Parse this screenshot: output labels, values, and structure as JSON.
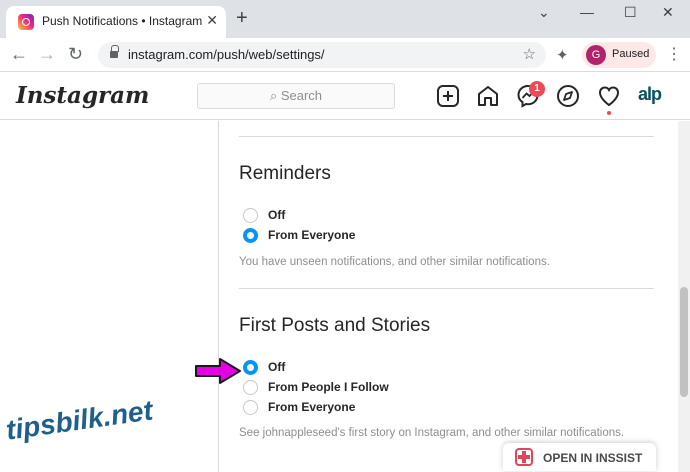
{
  "browser": {
    "tab_title": "Push Notifications • Instagram",
    "url": "instagram.com/push/web/settings/",
    "profile_initial": "G",
    "profile_status": "Paused"
  },
  "instagram": {
    "logo": "Instagram",
    "search_placeholder": "Search",
    "messages_badge": "1",
    "profile_handle": "alp"
  },
  "sections": {
    "reminders": {
      "title": "Reminders",
      "options": [
        {
          "label": "Off",
          "selected": false
        },
        {
          "label": "From Everyone",
          "selected": true
        }
      ],
      "description": "You have unseen notifications, and other similar notifications."
    },
    "first_posts": {
      "title": "First Posts and Stories",
      "options": [
        {
          "label": "Off",
          "selected": true
        },
        {
          "label": "From People I Follow",
          "selected": false
        },
        {
          "label": "From Everyone",
          "selected": false
        }
      ],
      "description": "See johnappleseed's first story on Instagram, and other similar notifications."
    }
  },
  "watermark": "tipsbilk.net",
  "insist_button": "OPEN IN INSSIST",
  "colors": {
    "accent": "#0095f6",
    "arrow": "#e600e6",
    "badge": "#ed4956"
  }
}
